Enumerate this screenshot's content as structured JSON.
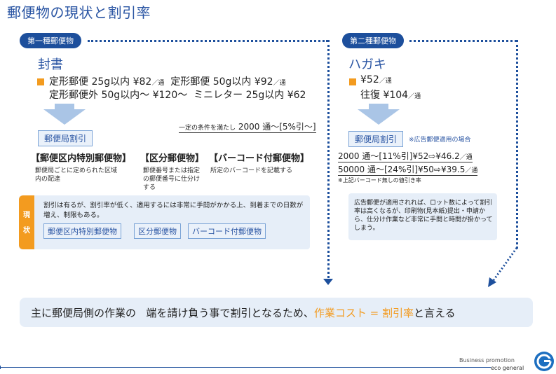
{
  "title": "郵便物の現状と割引率",
  "left": {
    "badge": "第一種郵便物",
    "heading": "封書",
    "rows": [
      {
        "a": "定形郵便 25g以内 ¥82",
        "a_unit": "／通",
        "b": "定形郵便 50g以内 ¥92",
        "b_unit": "／通"
      },
      {
        "a": "定形郵便外 50g以内〜 ¥120〜",
        "b": "ミニレター 25g以内 ¥62"
      }
    ],
    "condition_small": "一定の条件を満たし",
    "condition": "2000 通〜[5%引〜]",
    "discount_label": "郵便局割引",
    "categories": [
      {
        "name": "【郵便区内特別郵便物】",
        "desc": "郵便局ごとに定められた区域内の配達"
      },
      {
        "name": "【区分郵便物】",
        "desc": "郵便番号または指定の郵便番号に仕分けする"
      },
      {
        "name": "【バーコード付郵便物】",
        "desc": "所定のバーコードを記載する"
      }
    ],
    "status_label": "現状",
    "status_text": "割引は有るが、割引率が低く、適用するには非常に手間がかかる上、到着までの日数が増え、制限もある。",
    "tags": [
      "郵便区内特別郵便物",
      "区分郵便物",
      "バーコード付郵便物"
    ]
  },
  "right": {
    "badge": "第二種郵便物",
    "heading": "ハガキ",
    "price1": "¥52",
    "price1_unit": "／通",
    "price2": "往復 ¥104",
    "price2_unit": "／通",
    "discount_label": "郵便局割引",
    "discount_note": "※広告郵便適用の場合",
    "rates": [
      {
        "text": "2000 通〜[11%引]¥52⇨¥46.2",
        "unit": "／通"
      },
      {
        "text": "50000 通〜[24%引]¥50⇨¥39.5",
        "unit": "／通"
      }
    ],
    "rate_note": "※上記バーコード無しの値引き率",
    "panel_text": "広告郵便が適用されれば、ロット数によって割引率は高くなるが、印刷物(見本紙)提出・申請から、仕分け作業など非常に手間と時間が掛かってしまう。"
  },
  "banner": {
    "text1": "主に郵便局側の作業の",
    "text2": "端を請け負う事で割引となるため、",
    "highlight": "作業コスト = 割引率",
    "text3": "と言える"
  },
  "footer": {
    "line1": "Business promotion",
    "line2": "eco general"
  },
  "colors": {
    "accent": "#f39b1f",
    "brand": "#1d4f9c",
    "panel": "#e6eef8"
  }
}
